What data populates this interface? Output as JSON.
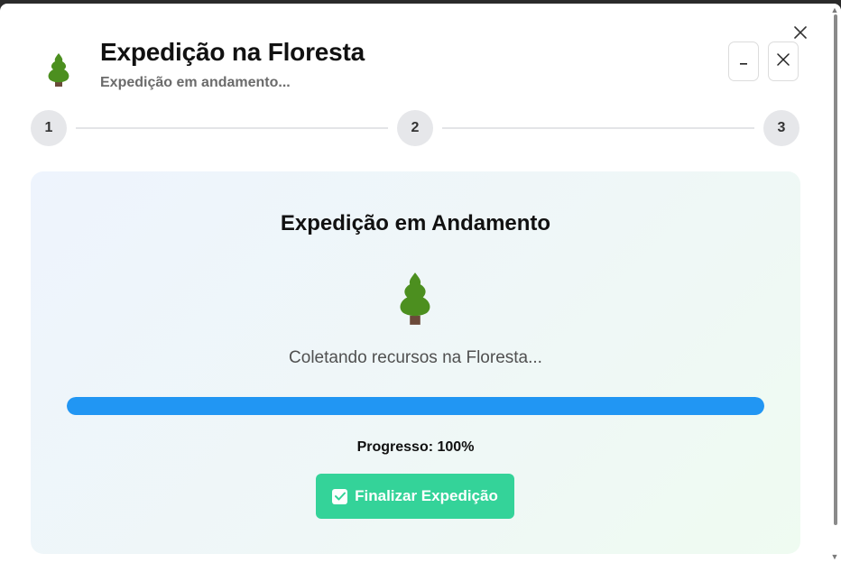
{
  "header": {
    "title": "Expedição na Floresta",
    "subtitle": "Expedição em andamento...",
    "icon": "evergreen-tree-icon"
  },
  "controls": {
    "minimize_icon": "minimize-icon",
    "close_icon": "close-icon"
  },
  "steps": [
    "1",
    "2",
    "3"
  ],
  "panel": {
    "title": "Expedição em Andamento",
    "icon": "evergreen-tree-icon",
    "status": "Coletando recursos na Floresta...",
    "progress_label": "Progresso:",
    "progress_value": "100%",
    "progress_fraction": 1.0,
    "finish_button_label": "Finalizar Expedição"
  },
  "colors": {
    "progress": "#2196f3",
    "finish_button": "#34d399",
    "tree_green": "#4c8f1f",
    "trunk": "#6b4a3a"
  }
}
